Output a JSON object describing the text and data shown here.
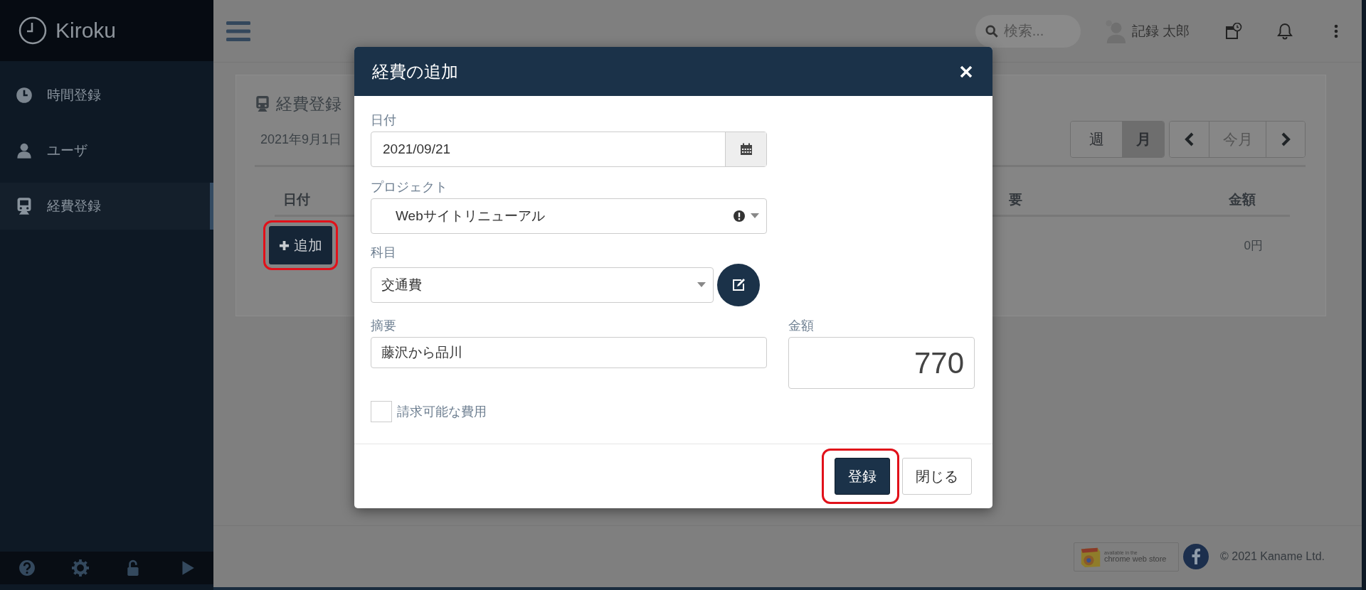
{
  "sidebar": {
    "logo": "Kiroku",
    "items": [
      {
        "label": "時間登録",
        "selected": false
      },
      {
        "label": "ユーザ",
        "selected": false
      },
      {
        "label": "経費登録",
        "selected": true
      }
    ]
  },
  "topbar": {
    "search": {
      "placeholder": "検索..."
    },
    "user_name": "記録 太郎"
  },
  "card": {
    "title": "経費登録",
    "date_range": "2021年9月1日",
    "period_toggle": [
      {
        "label": "週",
        "selected": false
      },
      {
        "label": "月",
        "selected": true
      }
    ],
    "today_button": "今月",
    "table": {
      "columns": [
        "日付",
        "要",
        "金額"
      ],
      "add_button": {
        "label": "追加",
        "highlighted": true
      },
      "total": "0円"
    }
  },
  "modal": {
    "title": "経費の追加",
    "date": {
      "label": "日付",
      "value": "2021/09/21"
    },
    "project": {
      "label": "プロジェクト",
      "value": "Webサイトリニューアル"
    },
    "category": {
      "label": "科目",
      "value": "交通費"
    },
    "description": {
      "label": "摘要",
      "value": "藤沢から品川"
    },
    "amount": {
      "label": "金額",
      "value": "770"
    },
    "billable": {
      "label": "請求可能な費用",
      "checked": false
    },
    "buttons": [
      {
        "label": "登録",
        "kind": "primary",
        "highlighted": true
      },
      {
        "label": "閉じる",
        "kind": "default",
        "highlighted": false
      }
    ]
  },
  "footer": {
    "badge": {
      "small": "available in the",
      "large": "chrome web store"
    },
    "copyright": "© 2021 Kaname Ltd."
  }
}
